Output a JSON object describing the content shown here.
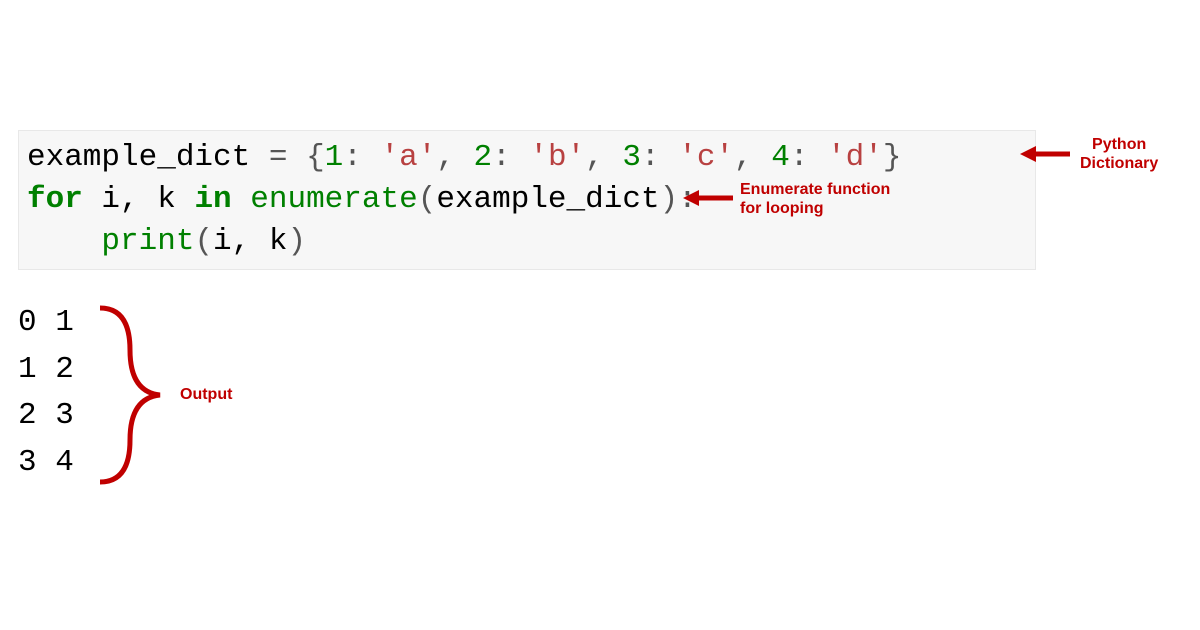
{
  "code": {
    "line1": {
      "var": "example_dict",
      "eq": " = ",
      "brace_open": "{",
      "k1": "1",
      "colon1": ": ",
      "v1": "'a'",
      "comma1": ", ",
      "k2": "2",
      "colon2": ": ",
      "v2": "'b'",
      "comma2": ", ",
      "k3": "3",
      "colon3": ": ",
      "v3": "'c'",
      "comma3": ", ",
      "k4": "4",
      "colon4": ": ",
      "v4": "'d'",
      "brace_close": "}"
    },
    "line2": {
      "for": "for",
      "vars": " i, k ",
      "in": "in",
      "sp": " ",
      "enum": "enumerate",
      "open": "(",
      "arg": "example_dict",
      "close": "):"
    },
    "line3": {
      "indent": "    ",
      "print": "print",
      "open": "(",
      "args": "i, k",
      "close": ")"
    }
  },
  "output": {
    "line1": "0 1",
    "line2": "1 2",
    "line3": "2 3",
    "line4": "3 4"
  },
  "annotations": {
    "dict_label_line1": "Python",
    "dict_label_line2": "Dictionary",
    "enum_label_line1": "Enumerate function",
    "enum_label_line2": "for looping",
    "output_label": "Output"
  }
}
